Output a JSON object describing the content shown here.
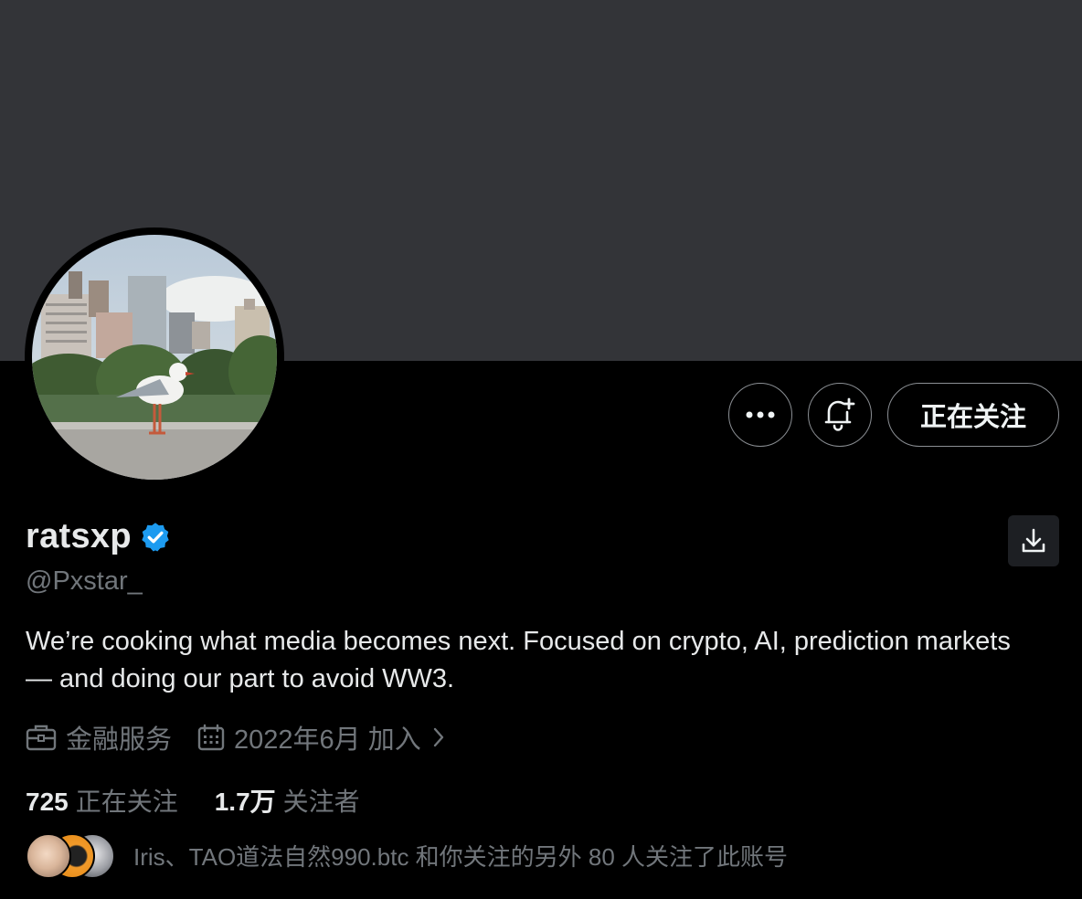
{
  "profile": {
    "display_name": "ratsxp",
    "handle": "@Pxstar_",
    "verified": true,
    "bio": "We’re cooking what media becomes next. Focused on crypto, AI, prediction markets — and doing our part to avoid WW3.",
    "category": "金融服务",
    "joined": "2022年6月 加入"
  },
  "actions": {
    "more_icon": "more-icon",
    "notify_icon": "bell-plus-icon",
    "follow_label": "正在关注",
    "download_icon": "download-icon"
  },
  "stats": {
    "following_count": "725",
    "following_label": "正在关注",
    "followers_count": "1.7万",
    "followers_label": "关注者"
  },
  "followed_by": {
    "text": "Iris、TAO道法自然990.btc 和你关注的另外 80 人关注了此账号"
  },
  "colors": {
    "banner": "#333438",
    "background": "#000000",
    "verified": "#1d9bf0",
    "secondary_text": "#71767b"
  }
}
